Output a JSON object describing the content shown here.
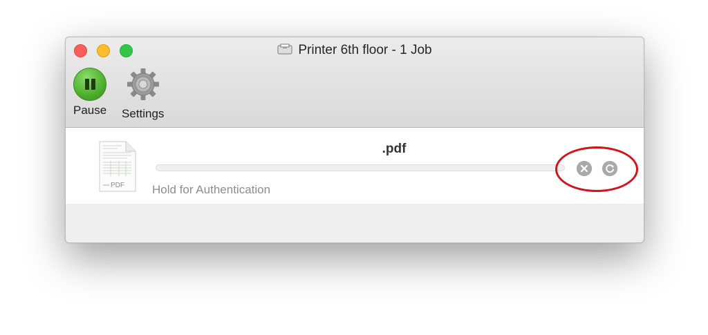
{
  "window": {
    "title": "Printer 6th floor - 1 Job",
    "title_icon": "printer-icon"
  },
  "toolbar": {
    "pause_label": "Pause",
    "settings_label": "Settings"
  },
  "job": {
    "document_name": ".pdf",
    "document_icon_text": "PDF",
    "status": "Hold for Authentication",
    "progress": 0
  },
  "colors": {
    "close": "#fc5f57",
    "minimize": "#fdbc2e",
    "maximize": "#33c748",
    "pause_green": "#4caf2c",
    "annotation_red": "#d0141c"
  },
  "icons": [
    "close-job-icon",
    "restart-job-icon",
    "gear-icon",
    "pause-icon",
    "pdf-document-icon"
  ]
}
